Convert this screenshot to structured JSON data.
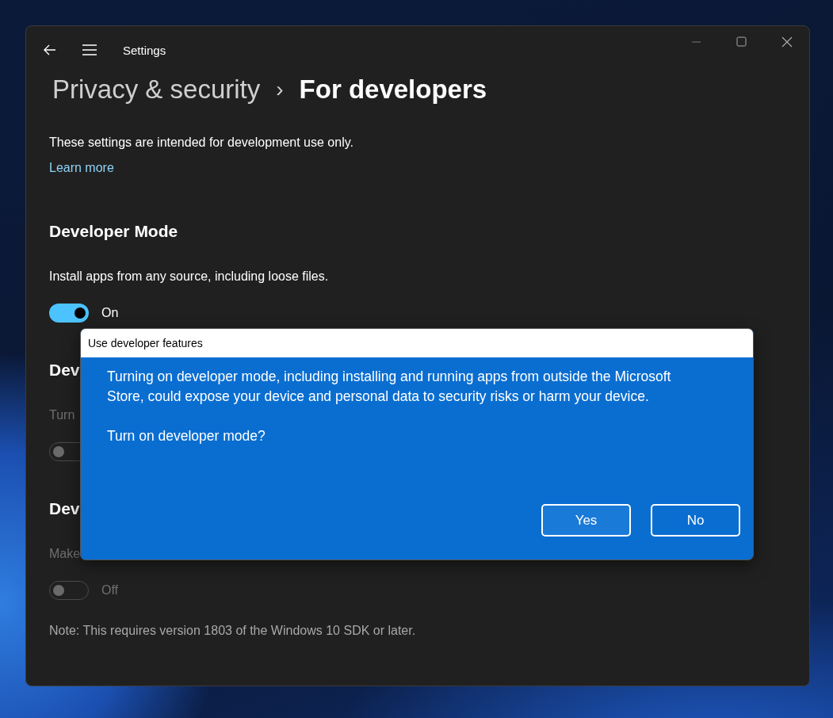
{
  "window": {
    "title": "Settings"
  },
  "breadcrumb": {
    "parent": "Privacy & security",
    "separator": "›",
    "current": "For developers"
  },
  "intro": {
    "text": "These settings are intended for development use only.",
    "link": "Learn more"
  },
  "sections": [
    {
      "heading": "Developer Mode",
      "description": "Install apps from any source, including loose files.",
      "disabled": false,
      "toggle": {
        "on": true,
        "label": "On"
      }
    },
    {
      "heading": "Dev",
      "description": "Turn",
      "disabled": true,
      "toggle": {
        "on": false
      }
    },
    {
      "heading": "Dev",
      "description": "Make",
      "disabled": true,
      "toggle": {
        "on": false,
        "label": "Off"
      },
      "note": "Note: This requires version 1803 of the Windows 10 SDK or later."
    }
  ],
  "dialog": {
    "title": "Use developer features",
    "message": "Turning on developer mode, including installing and running apps from outside the Microsoft Store, could expose your device and personal data to security risks or harm your device.",
    "question": "Turn on developer mode?",
    "buttons": [
      {
        "label": "Yes",
        "selected": true
      },
      {
        "label": "No",
        "selected": false
      }
    ]
  }
}
